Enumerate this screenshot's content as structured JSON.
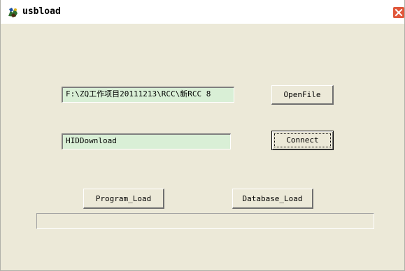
{
  "window": {
    "title": "usbload",
    "close_icon": "close-icon",
    "app_icon": "usbload-app-icon"
  },
  "file_path": {
    "value": "F:\\ZQ工作项目20111213\\RCC\\新RCC 8"
  },
  "device": {
    "value": "HIDDownload"
  },
  "buttons": {
    "open_file": "OpenFile",
    "connect": "Connect",
    "program_load": "Program_Load",
    "database_load": "Database_Load"
  },
  "progress": {
    "fraction": 0
  },
  "colors": {
    "field_background": "#d9efd6",
    "dialog_background": "#ece9d8",
    "close_button": "#e0573b"
  }
}
